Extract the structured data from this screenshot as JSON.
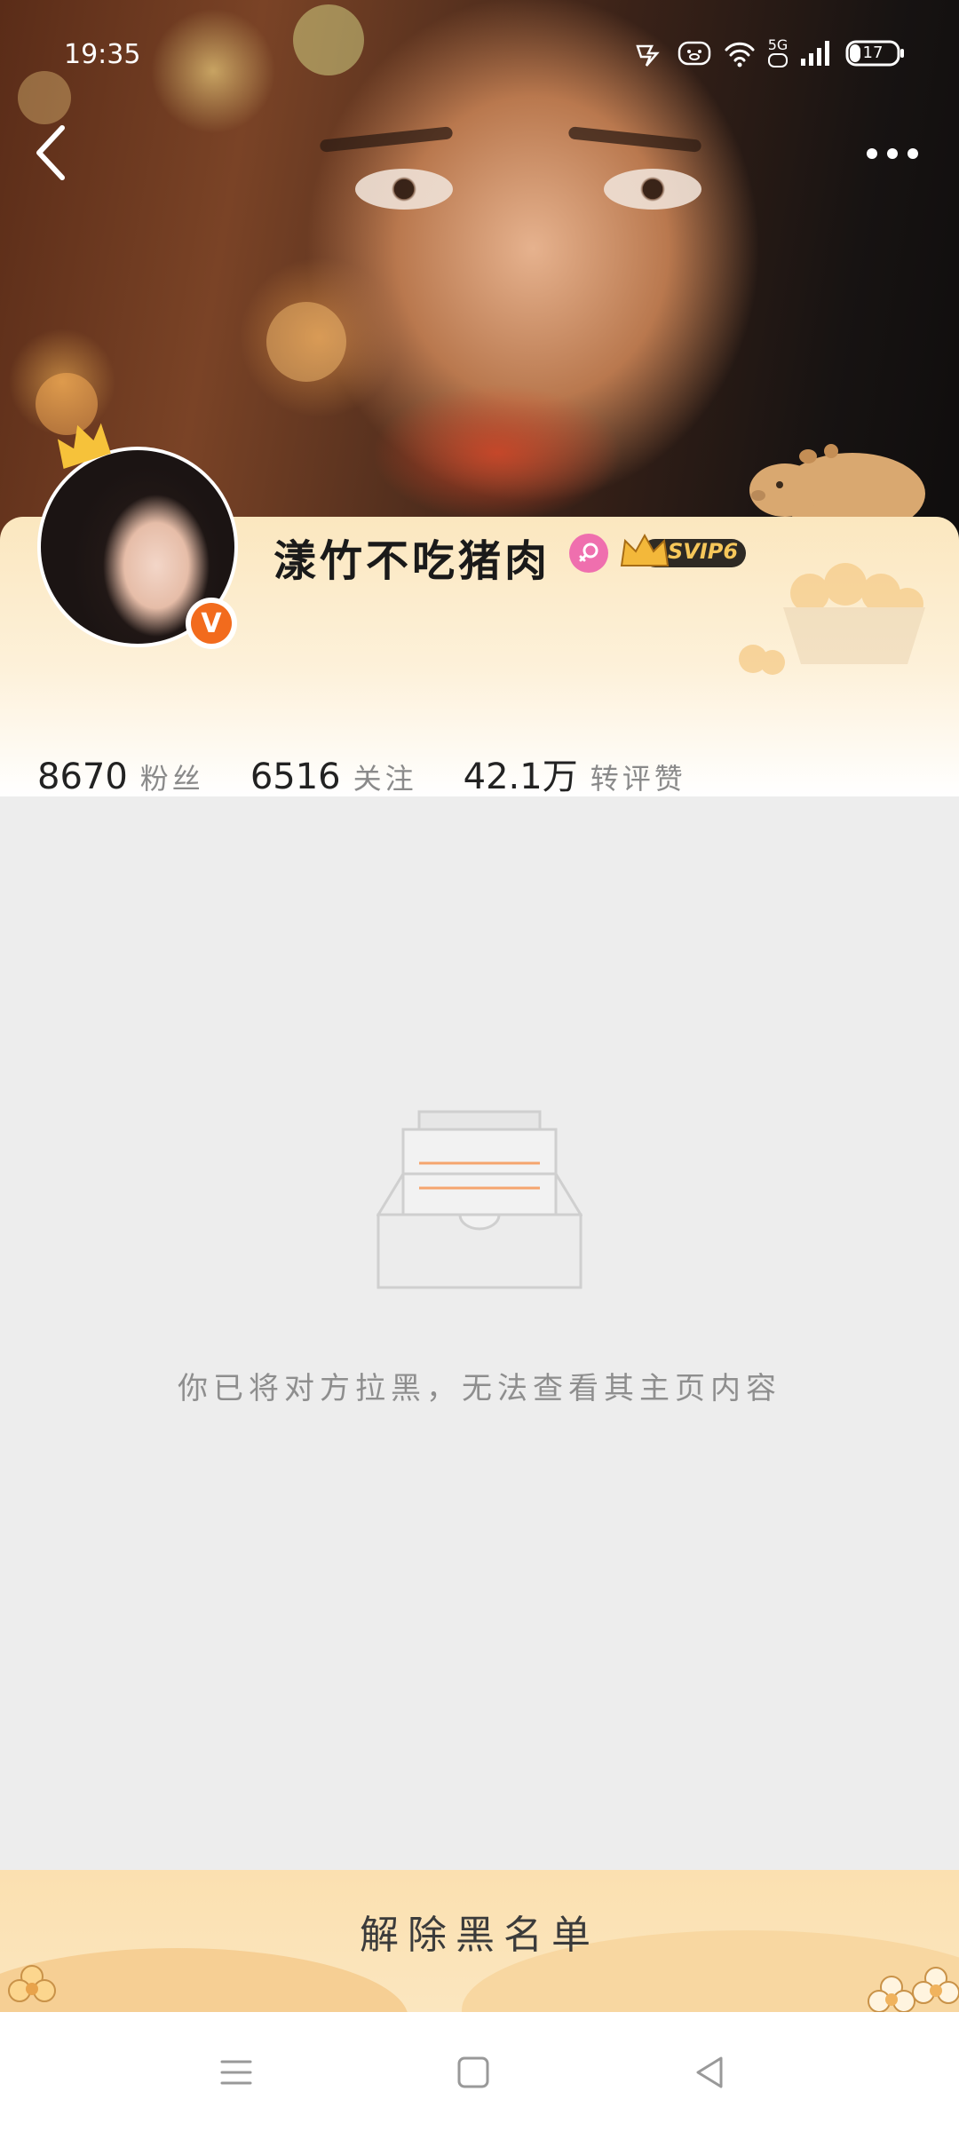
{
  "status_bar": {
    "time": "19:35",
    "network": "5G",
    "battery": "17"
  },
  "nav": {
    "back_icon": "chevron-left-icon",
    "more_icon": "more-horizontal-icon"
  },
  "profile": {
    "username": "漾竹不吃猪肉",
    "svip_label": "SVIP6",
    "verified_label": "V",
    "stats": [
      {
        "value": "8670",
        "label": "粉丝"
      },
      {
        "value": "6516",
        "label": "关注"
      },
      {
        "value": "42.1万",
        "label": "转评赞"
      }
    ]
  },
  "empty_state": {
    "message": "你已将对方拉黑，无法查看其主页内容"
  },
  "action_bar": {
    "unblock_label": "解除黑名单"
  },
  "colors": {
    "accent_orange": "#f26b1d",
    "female_pink": "#ef6fae",
    "card_gradient_top": "#fbe7bf",
    "page_bg": "#ededed"
  }
}
